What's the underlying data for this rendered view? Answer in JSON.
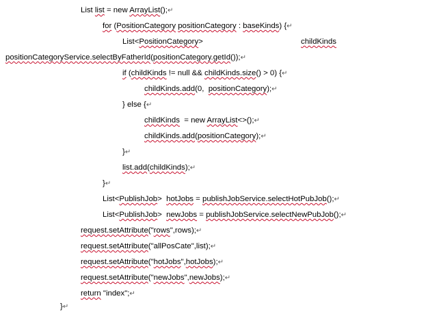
{
  "paragraph_mark": "↵",
  "lines": {
    "l1": [
      "List ",
      "list",
      " = new ",
      "ArrayList",
      "();"
    ],
    "l2": [
      "for",
      " (",
      "PositionCategory",
      " ",
      "positionCategory",
      " : ",
      "baseKinds",
      ") {"
    ],
    "l3": [
      "List<",
      "PositionCategory",
      ">"
    ],
    "l3b": [
      "childKinds"
    ],
    "l4": [
      "positionCategoryService.selectByFatherId",
      "(",
      "positionCategory.getId",
      "());"
    ],
    "l5": [
      "if",
      " (",
      "childKinds",
      " != null && ",
      "childKinds.size",
      "() > 0) {"
    ],
    "l6": [
      "childKinds.add",
      "(0,  ",
      "positionCategory",
      ");"
    ],
    "l7": [
      "} else {"
    ],
    "l8": [
      "childKinds",
      "  = new ",
      "ArrayList",
      "<>();"
    ],
    "l9": [
      "childKinds.add",
      "(",
      "positionCategory",
      ");"
    ],
    "l10": [
      "}"
    ],
    "l11": [
      "list.add",
      "(",
      "childKinds",
      ");"
    ],
    "l12": [
      "}"
    ],
    "l13": [
      "List<",
      "PublishJob",
      ">  ",
      "hotJobs",
      " = ",
      "publishJobService.selectHotPubJob",
      "();"
    ],
    "l14": [
      "List<",
      "PublishJob",
      ">  ",
      "newJobs",
      " = ",
      "publishJobService.selectNewPubJob",
      "();"
    ],
    "l15": [
      "request.setAttribute",
      "(\"",
      "rows",
      "\",rows);"
    ],
    "l16": [
      "request.setAttribute",
      "(\"allPosCate\",list);"
    ],
    "l17": [
      "request.setAttribute",
      "(\"",
      "hotJobs",
      "\",",
      "hotJobs",
      ");"
    ],
    "l18": [
      "request.setAttribute",
      "(\"",
      "newJobs",
      "\",",
      "newJobs",
      ");"
    ],
    "l19": [
      "return",
      " \"index\";"
    ],
    "l20": [
      "}"
    ]
  }
}
